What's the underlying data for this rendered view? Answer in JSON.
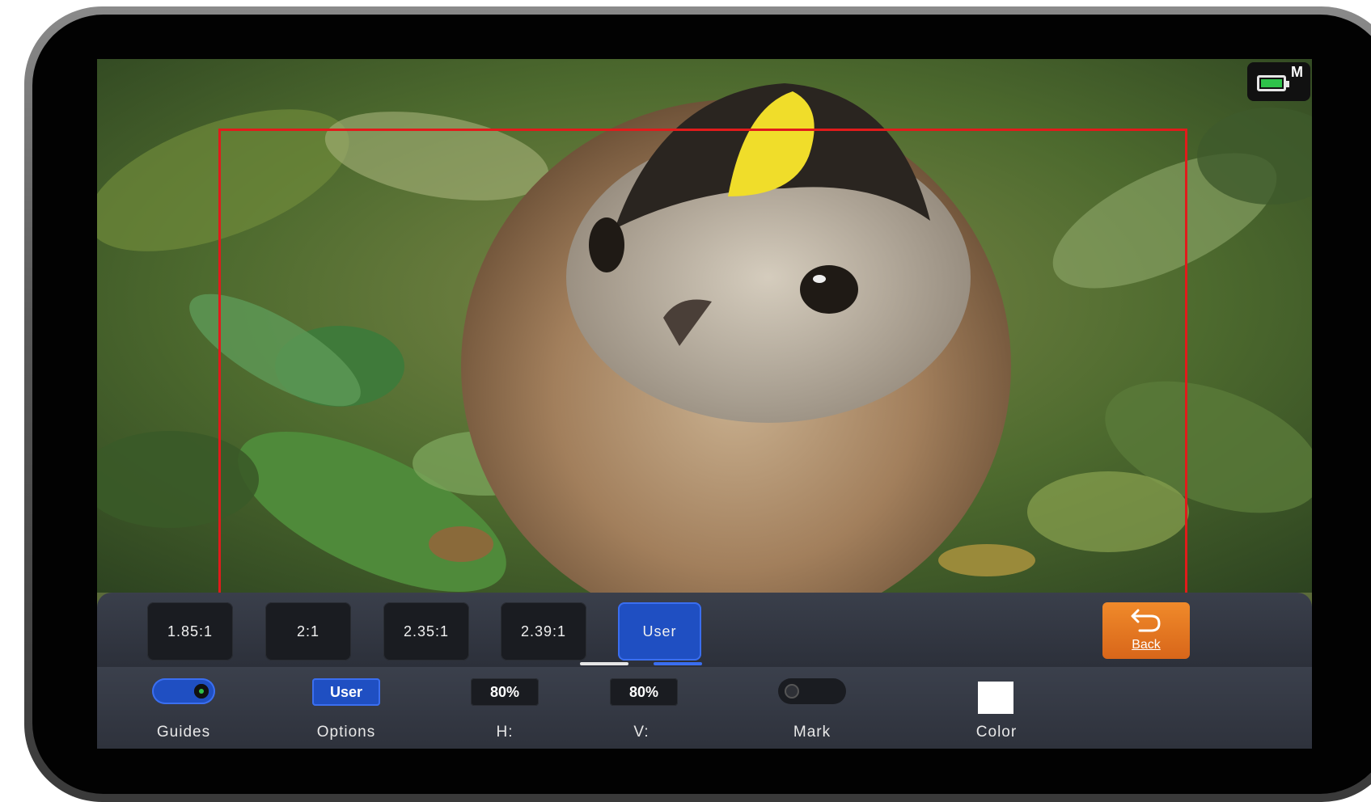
{
  "status": {
    "battery_icon": "battery-icon",
    "mode_label": "M"
  },
  "frame_marker": {
    "color": "#e11b1b"
  },
  "ratio_bar": {
    "options": [
      "1.85:1",
      "2:1",
      "2.35:1",
      "2.39:1",
      "User"
    ],
    "active": "User",
    "back_label": "Back"
  },
  "settings": {
    "guides": {
      "label": "Guides",
      "state": "on"
    },
    "options": {
      "label": "Options",
      "value": "User"
    },
    "h": {
      "label": "H:",
      "value": "80%"
    },
    "v": {
      "label": "V:",
      "value": "80%"
    },
    "mark": {
      "label": "Mark",
      "state": "off"
    },
    "color": {
      "label": "Color",
      "value": "#ffffff"
    }
  }
}
